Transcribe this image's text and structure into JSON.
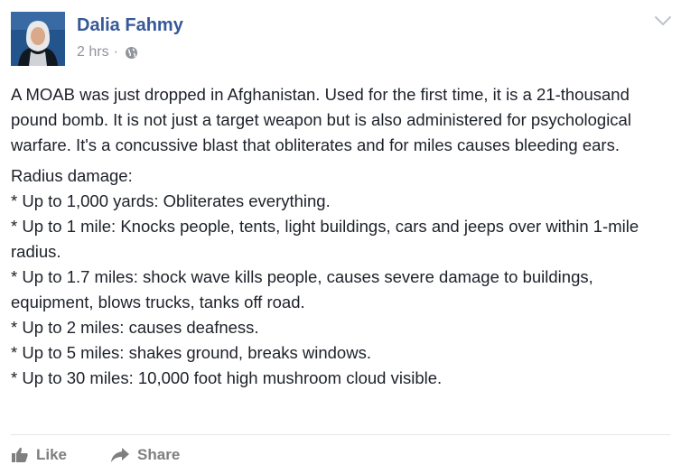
{
  "post": {
    "author": "Dalia Fahmy",
    "time": "2 hrs",
    "separator": "·",
    "privacy_icon": "globe-icon",
    "menu_icon": "chevron-down-icon",
    "paragraphs": [
      "A MOAB was just dropped in Afghanistan. Used for the first time, it is a 21-thousand pound bomb. It is not just a target weapon but is also administered for psychological warfare. It's a concussive blast that obliterates and for miles causes bleeding ears.",
      "Radius damage:",
      "* Up to 1,000 yards: Obliterates everything.",
      "* Up to 1 mile: Knocks people, tents, light buildings, cars and jeeps over within 1-mile radius.",
      "* Up to 1.7 miles: shock wave kills people, causes severe damage to buildings, equipment, blows trucks, tanks off road.",
      "* Up to 2 miles: causes deafness.",
      "* Up to 5 miles: shakes ground, breaks windows.",
      "* Up to 30 miles: 10,000 foot high mushroom cloud visible."
    ]
  },
  "actions": {
    "like_label": "Like",
    "like_icon": "thumbs-up-icon",
    "share_label": "Share",
    "share_icon": "share-arrow-icon"
  },
  "colors": {
    "author_link": "#365899",
    "meta_text": "#90949c",
    "action_text": "#7f7f7f",
    "avatar_bg": "#1f4f86"
  }
}
